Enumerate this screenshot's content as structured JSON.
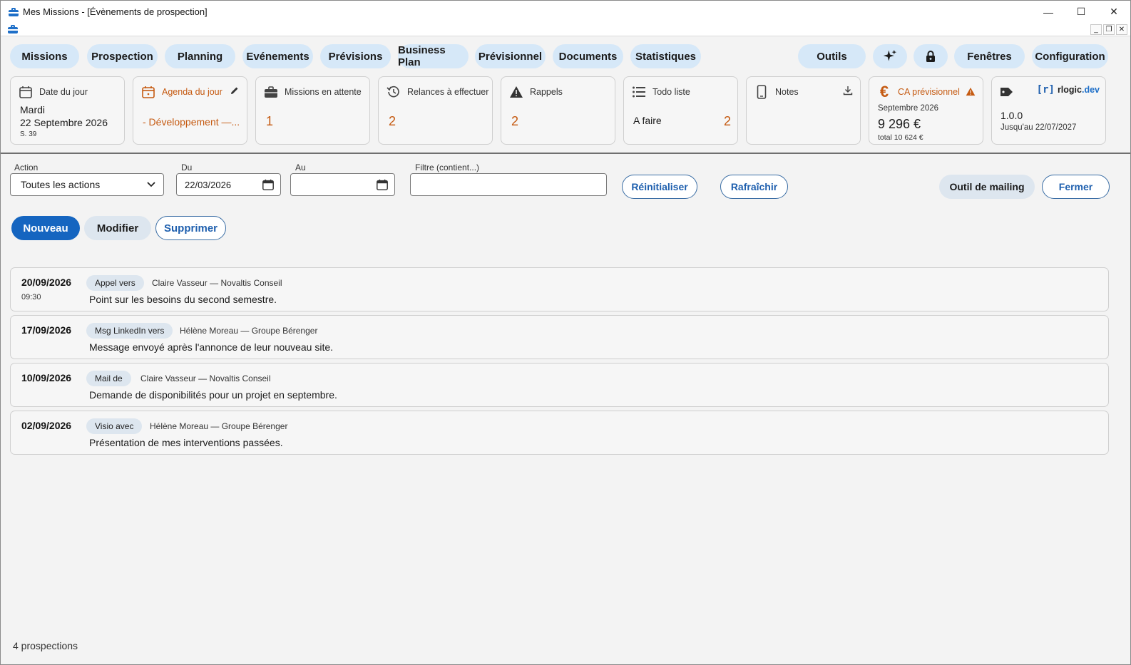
{
  "window": {
    "title": "Mes Missions - [Évènements de prospection]",
    "minimize": "—",
    "maximize": "☐",
    "close": "✕",
    "mdi_minimize": "_",
    "mdi_restore": "❐",
    "mdi_close": "✕"
  },
  "nav": {
    "items": [
      "Missions",
      "Prospection",
      "Planning",
      "Evénements",
      "Prévisions",
      "Business Plan",
      "Prévisionnel",
      "Documents",
      "Statistiques"
    ],
    "outils": "Outils",
    "fenetres": "Fenêtres",
    "configuration": "Configuration",
    "accent": "#d6e8f8"
  },
  "tiles": {
    "date_du_jour": {
      "label": "Date du jour",
      "day": "Mardi",
      "date": "22 Septembre 2026",
      "week": "S. 39"
    },
    "agenda": {
      "label": "Agenda du jour",
      "value": "- Développement —..."
    },
    "missions": {
      "label": "Missions en attente",
      "value": "1"
    },
    "relances": {
      "label": "Relances à effectuer",
      "value": "2"
    },
    "rappels": {
      "label": "Rappels",
      "value": "2"
    },
    "todo": {
      "label": "Todo liste",
      "item": "A faire",
      "value": "2"
    },
    "notes": {
      "label": "Notes"
    },
    "ca": {
      "label": "CA prévisionnel",
      "period": "Septembre 2026",
      "amount": "9 296 €",
      "total": "total 10 624 €"
    },
    "version": {
      "logo": "rlogic",
      "logo_suffix": ".dev",
      "version": "1.0.0",
      "until": "Jusqu'au 22/07/2027"
    },
    "orange": "#c55a11"
  },
  "filters": {
    "action_label": "Action",
    "action_value": "Toutes les actions",
    "du_label": "Du",
    "du_value": "22/03/2026",
    "au_label": "Au",
    "au_value": "",
    "filtre_label": "Filtre (contient...)",
    "filtre_value": "",
    "reinitialiser": "Réinitialiser",
    "rafraichir": "Rafraîchir",
    "outil_mailing": "Outil de mailing",
    "fermer": "Fermer"
  },
  "actions": {
    "nouveau": "Nouveau",
    "modifier": "Modifier",
    "supprimer": "Supprimer"
  },
  "events": [
    {
      "date": "20/09/2026",
      "time": "09:30",
      "type": "Appel vers",
      "who": "Claire Vasseur — Novaltis Conseil",
      "desc": "Point sur les besoins du second semestre."
    },
    {
      "date": "17/09/2026",
      "time": "",
      "type": "Msg LinkedIn vers",
      "who": "Hélène Moreau — Groupe Bérenger",
      "desc": "Message envoyé après l'annonce de leur nouveau site."
    },
    {
      "date": "10/09/2026",
      "time": "",
      "type": "Mail de",
      "who": "Claire Vasseur — Novaltis Conseil",
      "desc": "Demande de disponibilités pour un projet en septembre."
    },
    {
      "date": "02/09/2026",
      "time": "",
      "type": "Visio avec",
      "who": "Hélène Moreau — Groupe Bérenger",
      "desc": "Présentation de mes interventions passées."
    }
  ],
  "status": "4 prospections"
}
